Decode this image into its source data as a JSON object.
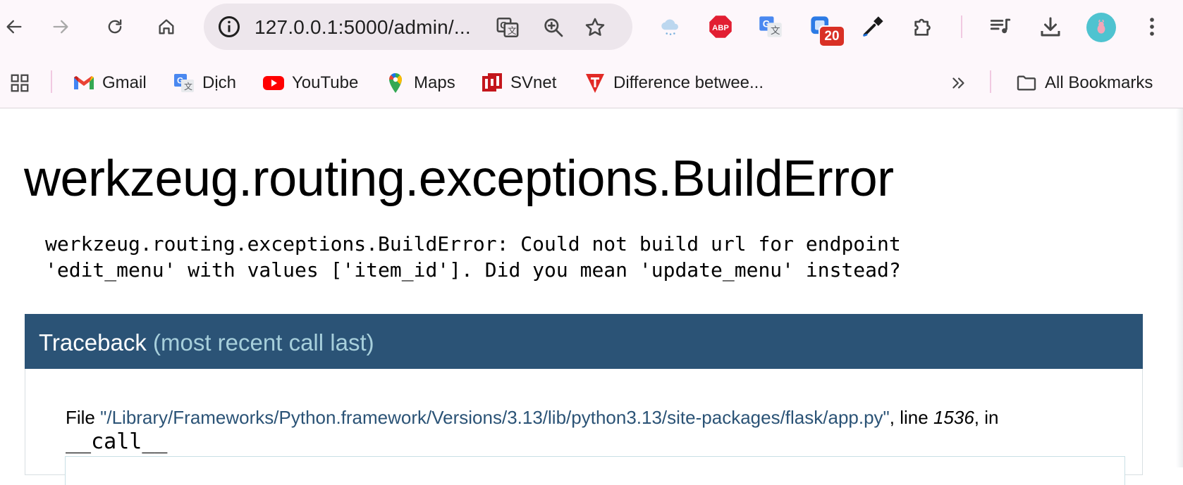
{
  "browser": {
    "url": "127.0.0.1:5000/admin/...",
    "extension_badge": "20",
    "bookmarks": [
      {
        "label": "Gmail",
        "icon": "gmail-icon"
      },
      {
        "label": "Dịch",
        "icon": "google-translate-icon"
      },
      {
        "label": "YouTube",
        "icon": "youtube-icon"
      },
      {
        "label": "Maps",
        "icon": "google-maps-icon"
      },
      {
        "label": "SVnet",
        "icon": "svnet-icon"
      },
      {
        "label": "Difference betwee...",
        "icon": "t-logo-icon"
      }
    ],
    "all_bookmarks": "All Bookmarks",
    "toolbar_icons": [
      "back-icon",
      "forward-icon",
      "reload-icon",
      "home-icon",
      "site-info-icon",
      "translate-icon",
      "zoom-icon",
      "star-icon",
      "weather-extension-icon",
      "adblock-plus-icon",
      "google-translate-extension-icon",
      "extension-with-badge-icon",
      "eyedropper-icon",
      "extensions-puzzle-icon",
      "media-controls-icon",
      "download-icon",
      "profile-avatar",
      "menu-kebab-icon"
    ],
    "abp_label": "ABP"
  },
  "page": {
    "title": "werkzeug.routing.exceptions.BuildError",
    "message": "werkzeug.routing.exceptions.BuildError: Could not build url for endpoint\n'edit_menu' with values ['item_id']. Did you mean 'update_menu' instead?",
    "traceback": {
      "heading": "Traceback",
      "heading_sub": "(most recent call last)",
      "frames": [
        {
          "prefix": "File ",
          "path": "\"/Library/Frameworks/Python.framework/Versions/3.13/lib/python3.13/site-packages/flask/app.py\"",
          "line_prefix": ", line ",
          "line": "1536",
          "in_text": ", in",
          "function": "__call__"
        }
      ]
    }
  },
  "colors": {
    "chrome_bg": "#fdf7fb",
    "omnibox_bg": "#ede6ec",
    "traceback_header": "#2b5376",
    "traceback_sub": "#a7cfdb",
    "badge_red": "#d93025"
  }
}
